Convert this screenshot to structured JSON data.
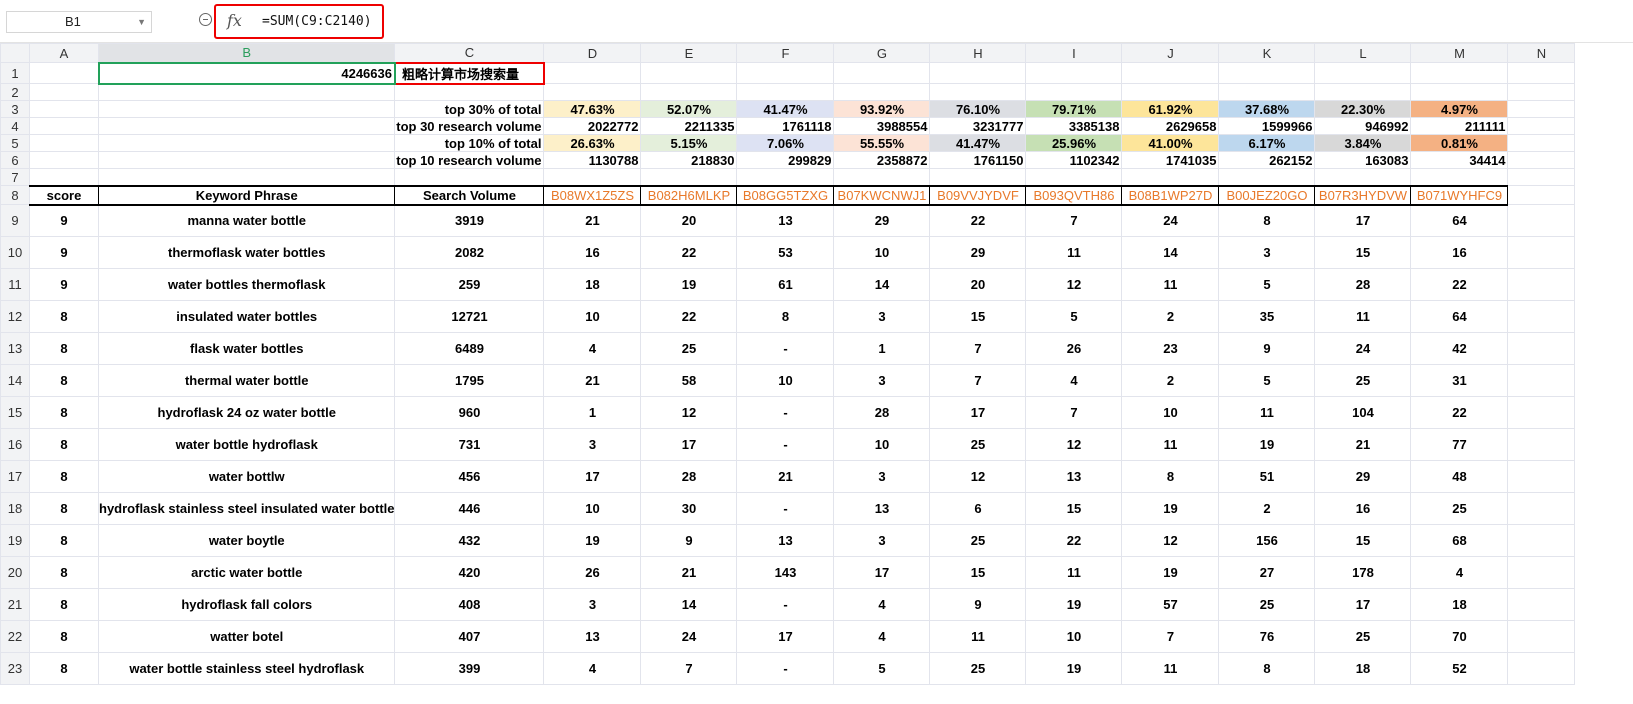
{
  "formula_bar": {
    "cell_ref": "B1",
    "formula": "=SUM(C9:C2140)",
    "fx_label": "fx"
  },
  "columns": [
    "A",
    "B",
    "C",
    "D",
    "E",
    "F",
    "G",
    "H",
    "I",
    "J",
    "K",
    "L",
    "M",
    "N"
  ],
  "row_numbers": [
    "1",
    "2",
    "3",
    "4",
    "5",
    "6",
    "7",
    "8",
    "9",
    "10",
    "11",
    "12",
    "13",
    "14",
    "15",
    "16",
    "17",
    "18",
    "19",
    "20",
    "21",
    "22",
    "23"
  ],
  "sheet": {
    "total_value": "4246636",
    "title": "粗略计算市场搜索量",
    "summary_rows": [
      {
        "label": "top 30% of total",
        "values": [
          "47.63%",
          "52.07%",
          "41.47%",
          "93.92%",
          "76.10%",
          "79.71%",
          "61.92%",
          "37.68%",
          "22.30%",
          "4.97%"
        ]
      },
      {
        "label": "top 30 research volume",
        "values": [
          "2022772",
          "2211335",
          "1761118",
          "3988554",
          "3231777",
          "3385138",
          "2629658",
          "1599966",
          "946992",
          "211111"
        ]
      },
      {
        "label": "top 10% of total",
        "values": [
          "26.63%",
          "5.15%",
          "7.06%",
          "55.55%",
          "41.47%",
          "25.96%",
          "41.00%",
          "6.17%",
          "3.84%",
          "0.81%"
        ]
      },
      {
        "label": "top 10 research volume",
        "values": [
          "1130788",
          "218830",
          "299829",
          "2358872",
          "1761150",
          "1102342",
          "1741035",
          "262152",
          "163083",
          "34414"
        ]
      }
    ],
    "header": {
      "score": "score",
      "keyword": "Keyword Phrase",
      "volume": "Search Volume",
      "asins": [
        "B08WX1Z5ZS",
        "B082H6MLKP",
        "B08GG5TZXG",
        "B07KWCNWJ1",
        "B09VVJYDVF",
        "B093QVTH86",
        "B08B1WP27D",
        "B00JEZ20GO",
        "B07R3HYDVW",
        "B071WYHFC9"
      ]
    },
    "rows": [
      {
        "score": "9",
        "keyword": "manna water bottle",
        "volume": "3919",
        "ranks": [
          "21",
          "20",
          "13",
          "29",
          "22",
          "7",
          "24",
          "8",
          "17",
          "64"
        ]
      },
      {
        "score": "9",
        "keyword": "thermoflask water bottles",
        "volume": "2082",
        "ranks": [
          "16",
          "22",
          "53",
          "10",
          "29",
          "11",
          "14",
          "3",
          "15",
          "16"
        ]
      },
      {
        "score": "9",
        "keyword": "water bottles thermoflask",
        "volume": "259",
        "ranks": [
          "18",
          "19",
          "61",
          "14",
          "20",
          "12",
          "11",
          "5",
          "28",
          "22"
        ]
      },
      {
        "score": "8",
        "keyword": "insulated water bottles",
        "volume": "12721",
        "ranks": [
          "10",
          "22",
          "8",
          "3",
          "15",
          "5",
          "2",
          "35",
          "11",
          "64"
        ]
      },
      {
        "score": "8",
        "keyword": "flask water bottles",
        "volume": "6489",
        "ranks": [
          "4",
          "25",
          "-",
          "1",
          "7",
          "26",
          "23",
          "9",
          "24",
          "42"
        ]
      },
      {
        "score": "8",
        "keyword": "thermal water bottle",
        "volume": "1795",
        "ranks": [
          "21",
          "58",
          "10",
          "3",
          "7",
          "4",
          "2",
          "5",
          "25",
          "31"
        ]
      },
      {
        "score": "8",
        "keyword": "hydroflask 24 oz water bottle",
        "volume": "960",
        "ranks": [
          "1",
          "12",
          "-",
          "28",
          "17",
          "7",
          "10",
          "11",
          "104",
          "22"
        ]
      },
      {
        "score": "8",
        "keyword": "water bottle hydroflask",
        "volume": "731",
        "ranks": [
          "3",
          "17",
          "-",
          "10",
          "25",
          "12",
          "11",
          "19",
          "21",
          "77"
        ]
      },
      {
        "score": "8",
        "keyword": "water bottlw",
        "volume": "456",
        "ranks": [
          "17",
          "28",
          "21",
          "3",
          "12",
          "13",
          "8",
          "51",
          "29",
          "48"
        ]
      },
      {
        "score": "8",
        "keyword": "hydroflask stainless steel insulated water bottle",
        "volume": "446",
        "ranks": [
          "10",
          "30",
          "-",
          "13",
          "6",
          "15",
          "19",
          "2",
          "16",
          "25"
        ]
      },
      {
        "score": "8",
        "keyword": "water boytle",
        "volume": "432",
        "ranks": [
          "19",
          "9",
          "13",
          "3",
          "25",
          "22",
          "12",
          "156",
          "15",
          "68"
        ]
      },
      {
        "score": "8",
        "keyword": "arctic water bottle",
        "volume": "420",
        "ranks": [
          "26",
          "21",
          "143",
          "17",
          "15",
          "11",
          "19",
          "27",
          "178",
          "4"
        ]
      },
      {
        "score": "8",
        "keyword": "hydroflask fall colors",
        "volume": "408",
        "ranks": [
          "3",
          "14",
          "-",
          "4",
          "9",
          "19",
          "57",
          "25",
          "17",
          "18"
        ]
      },
      {
        "score": "8",
        "keyword": "watter botel",
        "volume": "407",
        "ranks": [
          "13",
          "24",
          "17",
          "4",
          "11",
          "10",
          "7",
          "76",
          "25",
          "70"
        ]
      },
      {
        "score": "8",
        "keyword": "water bottle stainless steel hydroflask",
        "volume": "399",
        "ranks": [
          "4",
          "7",
          "-",
          "5",
          "25",
          "19",
          "11",
          "8",
          "18",
          "52"
        ]
      }
    ],
    "fill_colors": [
      "#fdf0c9",
      "#e4efdb",
      "#dde2f3",
      "#fce3d6",
      "#dcdee3",
      "#c6e0b4",
      "#fde59a",
      "#bdd7ee",
      "#d8d8d8",
      "#f4b183"
    ]
  }
}
